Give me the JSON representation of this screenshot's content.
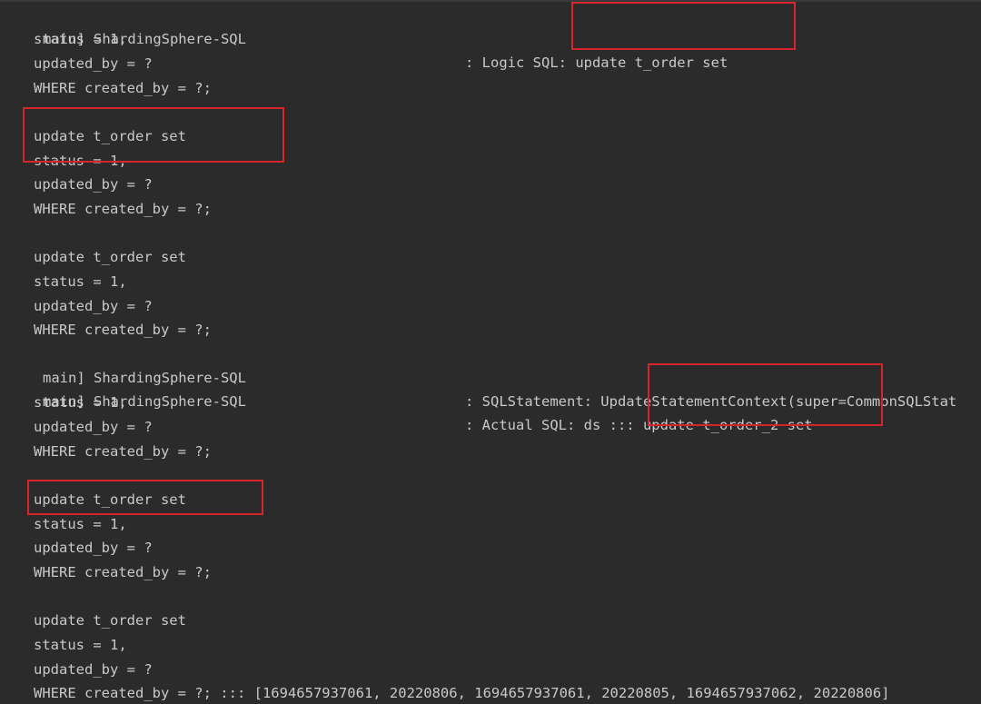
{
  "console": {
    "log1": {
      "prefix": "main] ShardingSphere-SQL",
      "message": ": Logic SQL: update t_order set"
    },
    "block1": [
      "status = 1,",
      "updated_by = ?",
      "WHERE created_by = ?;"
    ],
    "block2": [
      "update t_order set",
      "status = 1,",
      "updated_by = ?",
      "WHERE created_by = ?;"
    ],
    "block3": [
      "update t_order set",
      "status = 1,",
      "updated_by = ?",
      "WHERE created_by = ?;"
    ],
    "log2": {
      "prefix": "main] ShardingSphere-SQL",
      "message": ": SQLStatement: UpdateStatementContext(super=CommonSQLStat"
    },
    "log3": {
      "prefix": "main] ShardingSphere-SQL",
      "message": ": Actual SQL: ds ::: update t_order_2 set"
    },
    "block4": [
      "status = 1,",
      "updated_by = ?",
      "WHERE created_by = ?;"
    ],
    "block5": [
      "update t_order set",
      "status = 1,",
      "updated_by = ?",
      "WHERE created_by = ?;"
    ],
    "block6": [
      "update t_order set",
      "status = 1,",
      "updated_by = ?",
      "WHERE created_by = ?; ::: [1694657937061, 20220806, 1694657937061, 20220805, 1694657937062, 20220806]"
    ]
  },
  "colors": {
    "background": "#2b2b2b",
    "text": "#c9c9c9",
    "highlight": "#d8242c"
  }
}
